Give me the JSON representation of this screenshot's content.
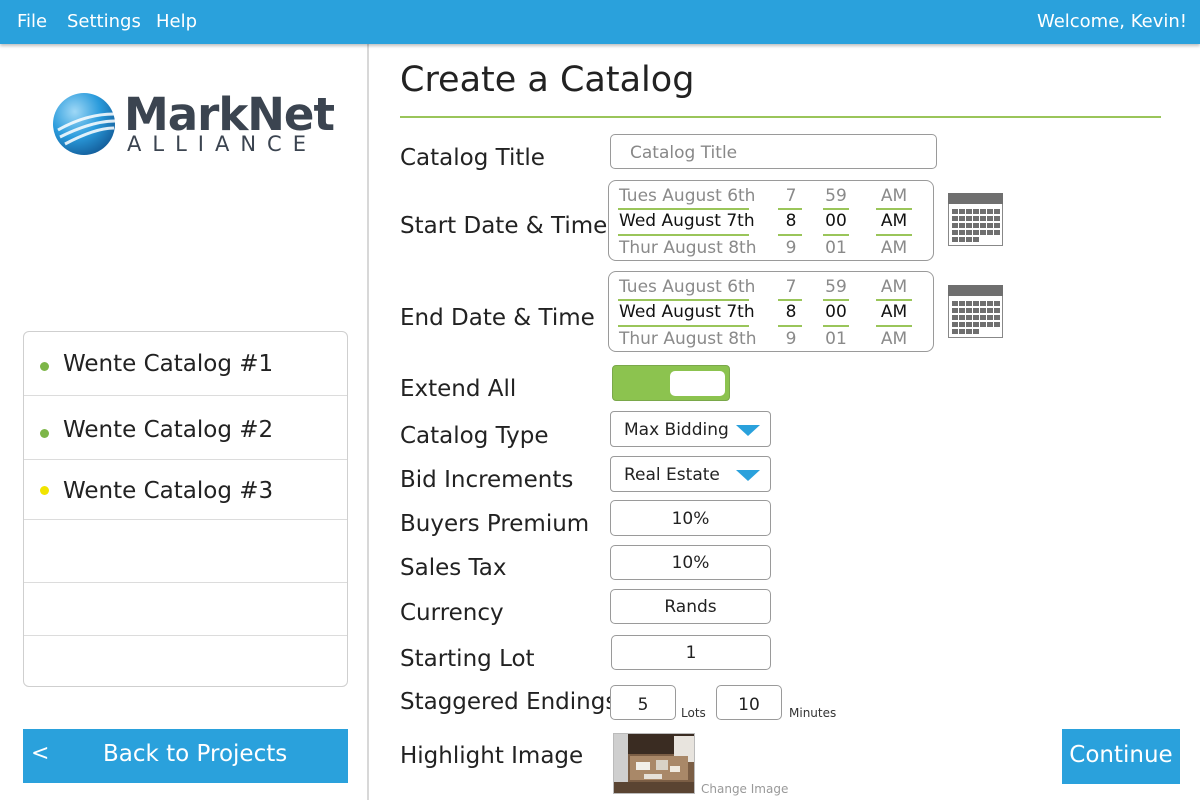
{
  "topbar": {
    "menu": [
      "File",
      "Settings",
      "Help"
    ],
    "welcome": "Welcome, Kevin!"
  },
  "logo": {
    "name": "MarkNet",
    "sub": "ALLIANCE"
  },
  "catalogs": [
    {
      "label": "Wente Catalog #1",
      "status_color": "#7db648"
    },
    {
      "label": "Wente Catalog #2",
      "status_color": "#7db648"
    },
    {
      "label": "Wente Catalog #3",
      "status_color": "#f1e400"
    }
  ],
  "back_button": {
    "arrow": "<",
    "label": "Back to Projects"
  },
  "page_title": "Create a Catalog",
  "form": {
    "catalog_title": {
      "label": "Catalog Title",
      "placeholder": "Catalog Title"
    },
    "start": {
      "label": "Start Date & Time",
      "rows": [
        {
          "date": "Tues August 6th",
          "hour": "7",
          "minute": "59",
          "ampm": "AM"
        },
        {
          "date": "Wed August 7th",
          "hour": "8",
          "minute": "00",
          "ampm": "AM"
        },
        {
          "date": "Thur August 8th",
          "hour": "9",
          "minute": "01",
          "ampm": "AM"
        }
      ]
    },
    "end": {
      "label": "End Date & Time",
      "rows": [
        {
          "date": "Tues August 6th",
          "hour": "7",
          "minute": "59",
          "ampm": "AM"
        },
        {
          "date": "Wed August 7th",
          "hour": "8",
          "minute": "00",
          "ampm": "AM"
        },
        {
          "date": "Thur August 8th",
          "hour": "9",
          "minute": "01",
          "ampm": "AM"
        }
      ]
    },
    "extend_all": {
      "label": "Extend All",
      "on": true
    },
    "catalog_type": {
      "label": "Catalog Type",
      "value": "Max Bidding"
    },
    "bid_increments": {
      "label": "Bid Increments",
      "value": "Real Estate"
    },
    "buyers_premium": {
      "label": "Buyers Premium",
      "value": "10%"
    },
    "sales_tax": {
      "label": "Sales Tax",
      "value": "10%"
    },
    "currency": {
      "label": "Currency",
      "value": "Rands"
    },
    "starting_lot": {
      "label": "Starting Lot",
      "value": "1"
    },
    "staggered": {
      "label": "Staggered Endings",
      "lots": "5",
      "lots_unit": "Lots",
      "minutes": "10",
      "minutes_unit": "Minutes"
    },
    "highlight": {
      "label": "Highlight Image",
      "change": "Change Image"
    }
  },
  "continue_button": "Continue",
  "colors": {
    "accent": "#2aa1dc",
    "green": "#8cc34f",
    "rule": "#9ac55a"
  },
  "icons": [
    "calendar-icon",
    "dropdown-caret-icon",
    "logo-globe-icon"
  ]
}
